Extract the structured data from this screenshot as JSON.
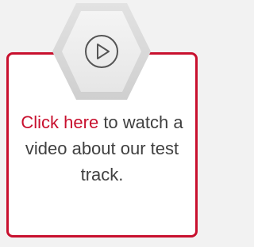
{
  "card": {
    "link_text": "Click here",
    "body_text": " to watch a video about our test track."
  },
  "icons": {
    "badge": "hexagon-badge",
    "play": "play-circle-icon"
  },
  "colors": {
    "accent": "#c8102e",
    "text": "#404040",
    "hex_outer": "#d9d9d9",
    "hex_inner": "#ececec",
    "background": "#f2f2f2"
  }
}
